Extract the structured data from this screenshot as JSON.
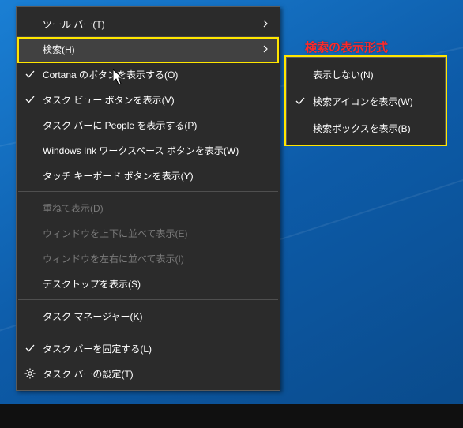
{
  "annotation": "検索の表示形式",
  "main_menu": {
    "items": [
      {
        "label": "ツール バー(T)",
        "icon": "",
        "submenu": true,
        "disabled": false,
        "hover": false
      },
      {
        "label": "検索(H)",
        "icon": "",
        "submenu": true,
        "disabled": false,
        "hover": true
      },
      {
        "label": "Cortana のボタンを表示する(O)",
        "icon": "check",
        "submenu": false,
        "disabled": false,
        "hover": false
      },
      {
        "label": "タスク ビュー ボタンを表示(V)",
        "icon": "check",
        "submenu": false,
        "disabled": false,
        "hover": false
      },
      {
        "label": "タスク バーに People を表示する(P)",
        "icon": "",
        "submenu": false,
        "disabled": false,
        "hover": false
      },
      {
        "label": "Windows Ink ワークスペース ボタンを表示(W)",
        "icon": "",
        "submenu": false,
        "disabled": false,
        "hover": false
      },
      {
        "label": "タッチ キーボード ボタンを表示(Y)",
        "icon": "",
        "submenu": false,
        "disabled": false,
        "hover": false
      },
      {
        "separator": true
      },
      {
        "label": "重ねて表示(D)",
        "icon": "",
        "submenu": false,
        "disabled": true,
        "hover": false
      },
      {
        "label": "ウィンドウを上下に並べて表示(E)",
        "icon": "",
        "submenu": false,
        "disabled": true,
        "hover": false
      },
      {
        "label": "ウィンドウを左右に並べて表示(I)",
        "icon": "",
        "submenu": false,
        "disabled": true,
        "hover": false
      },
      {
        "label": "デスクトップを表示(S)",
        "icon": "",
        "submenu": false,
        "disabled": false,
        "hover": false
      },
      {
        "separator": true
      },
      {
        "label": "タスク マネージャー(K)",
        "icon": "",
        "submenu": false,
        "disabled": false,
        "hover": false
      },
      {
        "separator": true
      },
      {
        "label": "タスク バーを固定する(L)",
        "icon": "check",
        "submenu": false,
        "disabled": false,
        "hover": false
      },
      {
        "label": "タスク バーの設定(T)",
        "icon": "gear",
        "submenu": false,
        "disabled": false,
        "hover": false
      }
    ]
  },
  "submenu": {
    "items": [
      {
        "label": "表示しない(N)",
        "icon": ""
      },
      {
        "label": "検索アイコンを表示(W)",
        "icon": "check"
      },
      {
        "label": "検索ボックスを表示(B)",
        "icon": ""
      }
    ]
  }
}
